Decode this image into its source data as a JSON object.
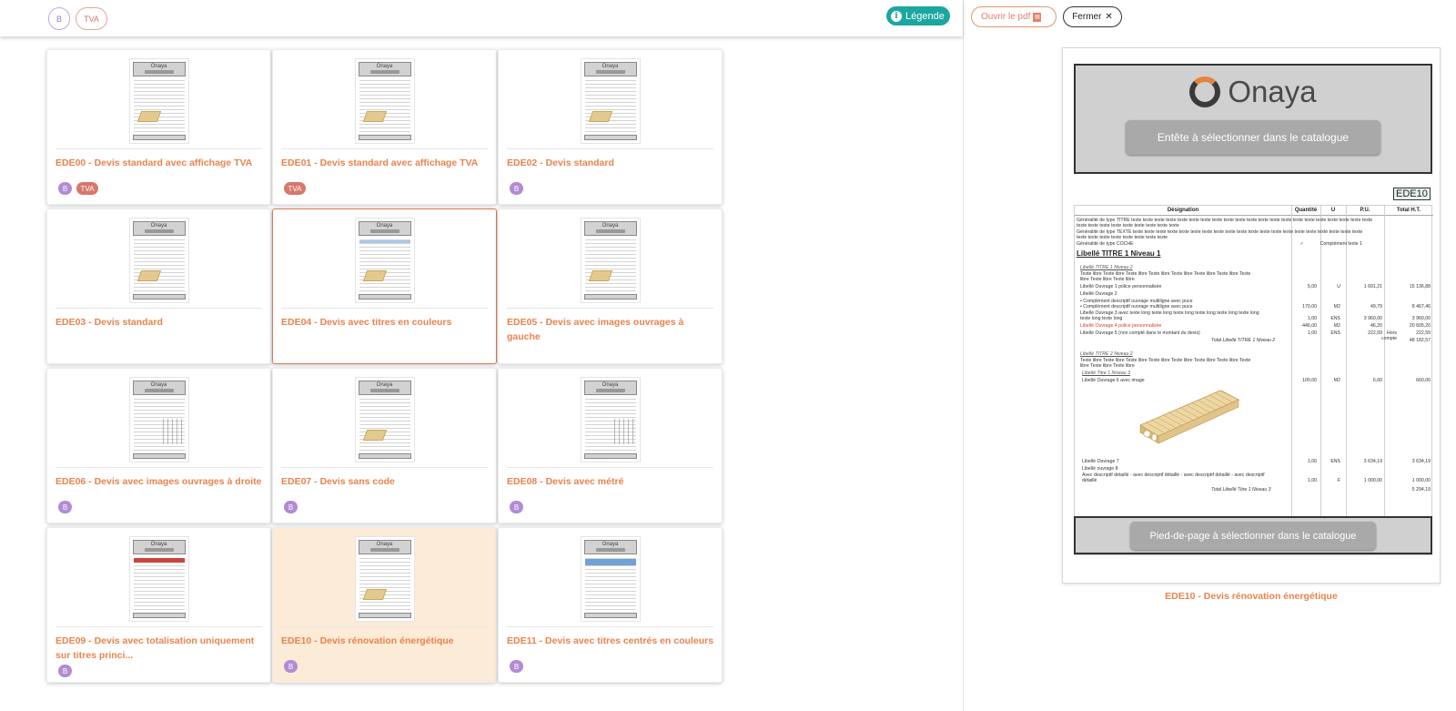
{
  "filters": {
    "b": "B",
    "tva": "TVA"
  },
  "legend_label": "Légende",
  "cards": [
    {
      "title": "EDE00 - Devis standard avec affichage TVA",
      "tags": [
        "B",
        "TVA"
      ]
    },
    {
      "title": "EDE01 - Devis standard avec affichage TVA",
      "tags": [
        "TVA"
      ]
    },
    {
      "title": "EDE02 - Devis standard",
      "tags": [
        "B"
      ]
    },
    {
      "title": "EDE03 - Devis standard",
      "tags": []
    },
    {
      "title": "EDE04 - Devis avec titres en couleurs",
      "tags": []
    },
    {
      "title": "EDE05 - Devis avec images ouvrages à gauche",
      "tags": []
    },
    {
      "title": "EDE06 - Devis avec images ouvrages à droite",
      "tags": [
        "B"
      ]
    },
    {
      "title": "EDE07 - Devis sans code",
      "tags": [
        "B"
      ]
    },
    {
      "title": "EDE08 - Devis avec métré",
      "tags": [
        "B"
      ]
    },
    {
      "title": "EDE09 - Devis avec totalisation uniquement sur titres princi...",
      "tags": [
        "B"
      ]
    },
    {
      "title": "EDE10 - Devis rénovation énergétique",
      "tags": [
        "B"
      ]
    },
    {
      "title": "EDE11 - Devis avec titres centrés en couleurs",
      "tags": [
        "B"
      ]
    }
  ],
  "thumb_logo": "Onaya",
  "actions": {
    "open_pdf": "Ouvrir le pdf",
    "close": "Fermer"
  },
  "preview": {
    "logo": "Onaya",
    "header_button": "Entête à sélectionner dans le catalogue",
    "code": "EDE10",
    "columns": [
      "Désignation",
      "Quantité",
      "U",
      "P.U.",
      "Total H.T."
    ],
    "rows": [
      "Généralité de type TITRE texte texte texte texte texte texte texte texte texte texte texte texte texte texte texte texte texte texte texte texte texte",
      "texte texte texte texte texte texte texte texte texte",
      "Généralité de type TEXTE texte texte texte texte texte texte texte texte texte texte texte texte texte texte texte texte texte texte texte texte",
      "texte texte texte texte texte texte texte texte",
      "Généralité de type COCHE",
      "Libellé TITRE 1 Niveau 1",
      "Libellé TITRE 1 Niveau 2",
      "Texte libre Texte libre Texte libre Texte libre Texte libre Texte libre Texte libre Texte",
      "libre Texte libre Texte libre",
      "Libellé Ouvrage 1 police personnalisée",
      "Libellé Ouvrage 2",
      "• Complément descriptif ouvrage multiligne avec puce",
      "• Complément descriptif ouvrage multiligne avec puce",
      "Libellé Ouvrage 3 avec texte long texte long texte long texte long texte long texte long",
      "texte long texte long",
      "Libellé Ouvrage 4 police personnalisée",
      "Libellé Ouvrage 5 (non compté dans le montant du devis)",
      "Total Libellé TITRE 1 Niveau 2",
      "Libellé TITRE 2 Niveau 2",
      "Texte libre Texte libre Texte libre Texte libre Texte libre Texte libre Texte libre Texte",
      "libre Texte libre Texte libre",
      "Libellé Titre 1 Niveau 3",
      "Libellé Ouvrage 6 avec image",
      "Libellé Ouvrage 7",
      "Libellé ouvrage 8",
      "Avec descriptif détaillé - avec descriptif détaillé - avec descriptif détaillé - avec descriptif",
      "détaillé",
      "Total Libellé Titre 1 Niveau 3"
    ],
    "check_mark": "✓",
    "complement": "Complément texte 1",
    "numbers": {
      "r1": [
        "5,00",
        "U",
        "1 691,21",
        "15 136,88"
      ],
      "r2": [
        "170,00",
        "M2",
        "49,79",
        "8 467,46"
      ],
      "r3": [
        "1,00",
        "ENS",
        "3 960,00",
        "3 960,00"
      ],
      "r4": [
        "446,00",
        "M2",
        "46,20",
        "20 605,20"
      ],
      "r5": [
        "1,00",
        "ENS",
        "222,59",
        "222,59"
      ],
      "tot1": "48 182,57",
      "r6": [
        "100,00",
        "M2",
        "6,60",
        "660,00"
      ],
      "r7": [
        "1,00",
        "ENS",
        "3 634,19",
        "3 634,19"
      ],
      "r8": [
        "1,00",
        "F",
        "1 000,00",
        "1 000,00"
      ],
      "tot2": "5 294,19",
      "note": "Hors compte"
    },
    "footer_button": "Pied-de-page à sélectionner dans le catalogue",
    "caption": "EDE10 - Devis rénovation énergétique"
  }
}
